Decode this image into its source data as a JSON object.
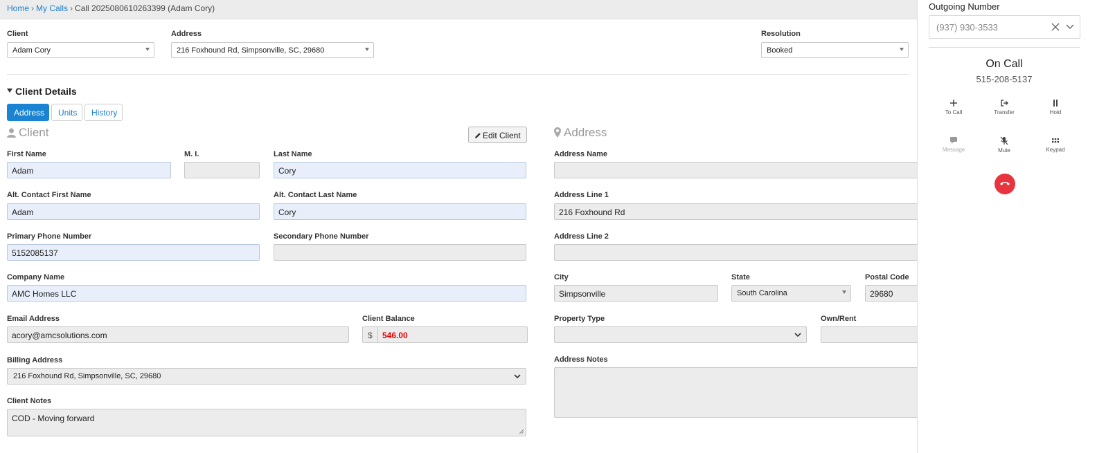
{
  "breadcrumb": {
    "home": "Home",
    "my_calls": "My Calls",
    "current": "Call 2025080610263399 (Adam Cory)"
  },
  "header_fields": {
    "client_label": "Client",
    "client_value": "Adam Cory",
    "address_label": "Address",
    "address_value": "216 Foxhound Rd, Simpsonville, SC, 29680",
    "resolution_label": "Resolution",
    "resolution_value": "Booked"
  },
  "section": {
    "title": "Client Details",
    "tabs": [
      {
        "label": "Address",
        "active": true
      },
      {
        "label": "Units",
        "active": false
      },
      {
        "label": "History",
        "active": false
      }
    ]
  },
  "client_panel": {
    "title": "Client",
    "edit_button": "Edit Client",
    "first_name_label": "First Name",
    "first_name": "Adam",
    "mi_label": "M. I.",
    "mi": "",
    "last_name_label": "Last Name",
    "last_name": "Cory",
    "alt_first_label": "Alt. Contact First Name",
    "alt_first": "Adam",
    "alt_last_label": "Alt. Contact Last Name",
    "alt_last": "Cory",
    "primary_phone_label": "Primary Phone Number",
    "primary_phone": "5152085137",
    "secondary_phone_label": "Secondary Phone Number",
    "secondary_phone": "",
    "company_label": "Company Name",
    "company": "AMC Homes LLC",
    "email_label": "Email Address",
    "email": "acory@amcsolutions.com",
    "balance_label": "Client Balance",
    "balance_currency": "$",
    "balance": "546.00",
    "billing_label": "Billing Address",
    "billing": "216 Foxhound Rd, Simpsonville, SC, 29680",
    "notes_label": "Client Notes",
    "notes": "COD - Moving forward"
  },
  "address_panel": {
    "title": "Address",
    "address_name_label": "Address Name",
    "address_name": "",
    "line1_label": "Address Line 1",
    "line1": "216 Foxhound Rd",
    "line2_label": "Address Line 2",
    "line2": "",
    "city_label": "City",
    "city": "Simpsonville",
    "state_label": "State",
    "state": "South Carolina",
    "postal_label": "Postal Code",
    "postal": "29680",
    "property_type_label": "Property Type",
    "property_type": "",
    "own_rent_label": "Own/Rent",
    "own_rent": "",
    "notes_label": "Address Notes",
    "notes": ""
  },
  "call_panel": {
    "outgoing_label": "Outgoing Number",
    "outgoing_number": "(937) 930-3533",
    "status": "On Call",
    "number": "515-208-5137",
    "buttons": [
      {
        "label": "To Call",
        "icon": "plus-icon"
      },
      {
        "label": "Transfer",
        "icon": "transfer-icon"
      },
      {
        "label": "Hold",
        "icon": "pause-icon"
      },
      {
        "label": "Message",
        "icon": "message-icon"
      },
      {
        "label": "Mute",
        "icon": "mic-off-icon"
      },
      {
        "label": "Keypad",
        "icon": "keypad-icon"
      }
    ],
    "hangup_color": "#e8343f"
  },
  "colors": {
    "link": "#1a7fd0",
    "active_tab": "#1a84d2",
    "balance": "#e40000",
    "highlight_field": "#e8effb"
  }
}
